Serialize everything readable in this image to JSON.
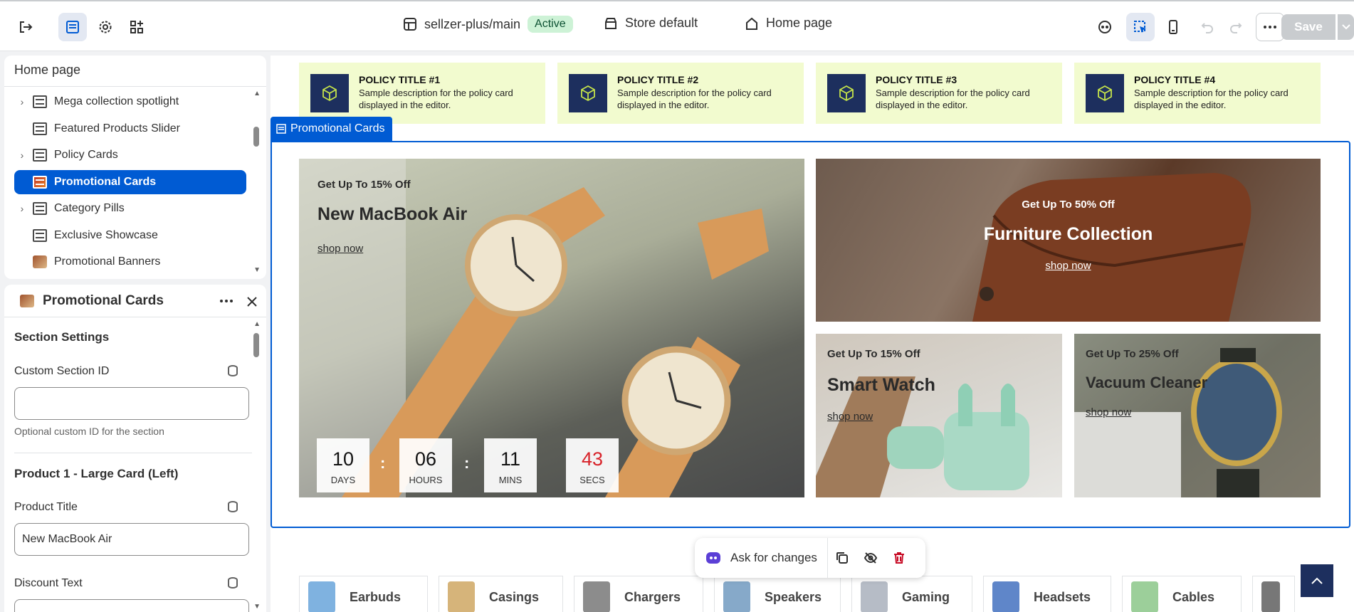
{
  "topbar": {
    "store": "sellzer-plus/main",
    "status": "Active",
    "theme": "Store default",
    "page": "Home page",
    "save_label": "Save"
  },
  "navigator": {
    "title": "Home page",
    "items": [
      {
        "label": "Mega collection spotlight",
        "expandable": true
      },
      {
        "label": "Featured Products Slider",
        "expandable": false
      },
      {
        "label": "Policy Cards",
        "expandable": true
      },
      {
        "label": "Promotional Cards",
        "expandable": false,
        "selected": true
      },
      {
        "label": "Category Pills",
        "expandable": true
      },
      {
        "label": "Exclusive Showcase",
        "expandable": false
      },
      {
        "label": "Promotional Banners",
        "expandable": false
      }
    ]
  },
  "settings": {
    "title": "Promotional Cards",
    "section_heading": "Section Settings",
    "custom_id_label": "Custom Section ID",
    "custom_id_value": "",
    "custom_id_hint": "Optional custom ID for the section",
    "product1_heading": "Product 1 - Large Card (Left)",
    "product_title_label": "Product Title",
    "product_title_value": "New MacBook Air",
    "discount_label": "Discount Text"
  },
  "policies": [
    {
      "title": "POLICY TITLE #1",
      "desc": "Sample description for the policy card displayed in the editor."
    },
    {
      "title": "POLICY TITLE #2",
      "desc": "Sample description for the policy card displayed in the editor."
    },
    {
      "title": "POLICY TITLE #3",
      "desc": "Sample description for the policy card displayed in the editor."
    },
    {
      "title": "POLICY TITLE #4",
      "desc": "Sample description for the policy card displayed in the editor."
    }
  ],
  "section_tag": "Promotional Cards",
  "promos": {
    "large": {
      "discount": "Get Up To 15% Off",
      "title": "New MacBook Air",
      "link": "shop now"
    },
    "top_right": {
      "discount": "Get Up To 50% Off",
      "title": "Furniture Collection",
      "link": "shop now"
    },
    "bottom_left": {
      "discount": "Get Up To 15% Off",
      "title": "Smart Watch",
      "link": "shop now"
    },
    "bottom_right": {
      "discount": "Get Up To 25% Off",
      "title": "Vacuum Cleaner",
      "link": "shop now"
    }
  },
  "countdown": [
    {
      "value": "10",
      "label": "DAYS"
    },
    {
      "value": "06",
      "label": "HOURS"
    },
    {
      "value": "11",
      "label": "MINS"
    },
    {
      "value": "43",
      "label": "SECS"
    }
  ],
  "ai_bar": {
    "ask": "Ask for changes"
  },
  "category_pills": [
    "Earbuds",
    "Casings",
    "Chargers",
    "Speakers",
    "Gaming",
    "Headsets",
    "Cables"
  ],
  "colors": {
    "accent": "#005bd3",
    "policy_bg": "#f2fbcf",
    "policy_icon_bg": "#1d2f5e",
    "countdown_secs": "#d8232a"
  }
}
